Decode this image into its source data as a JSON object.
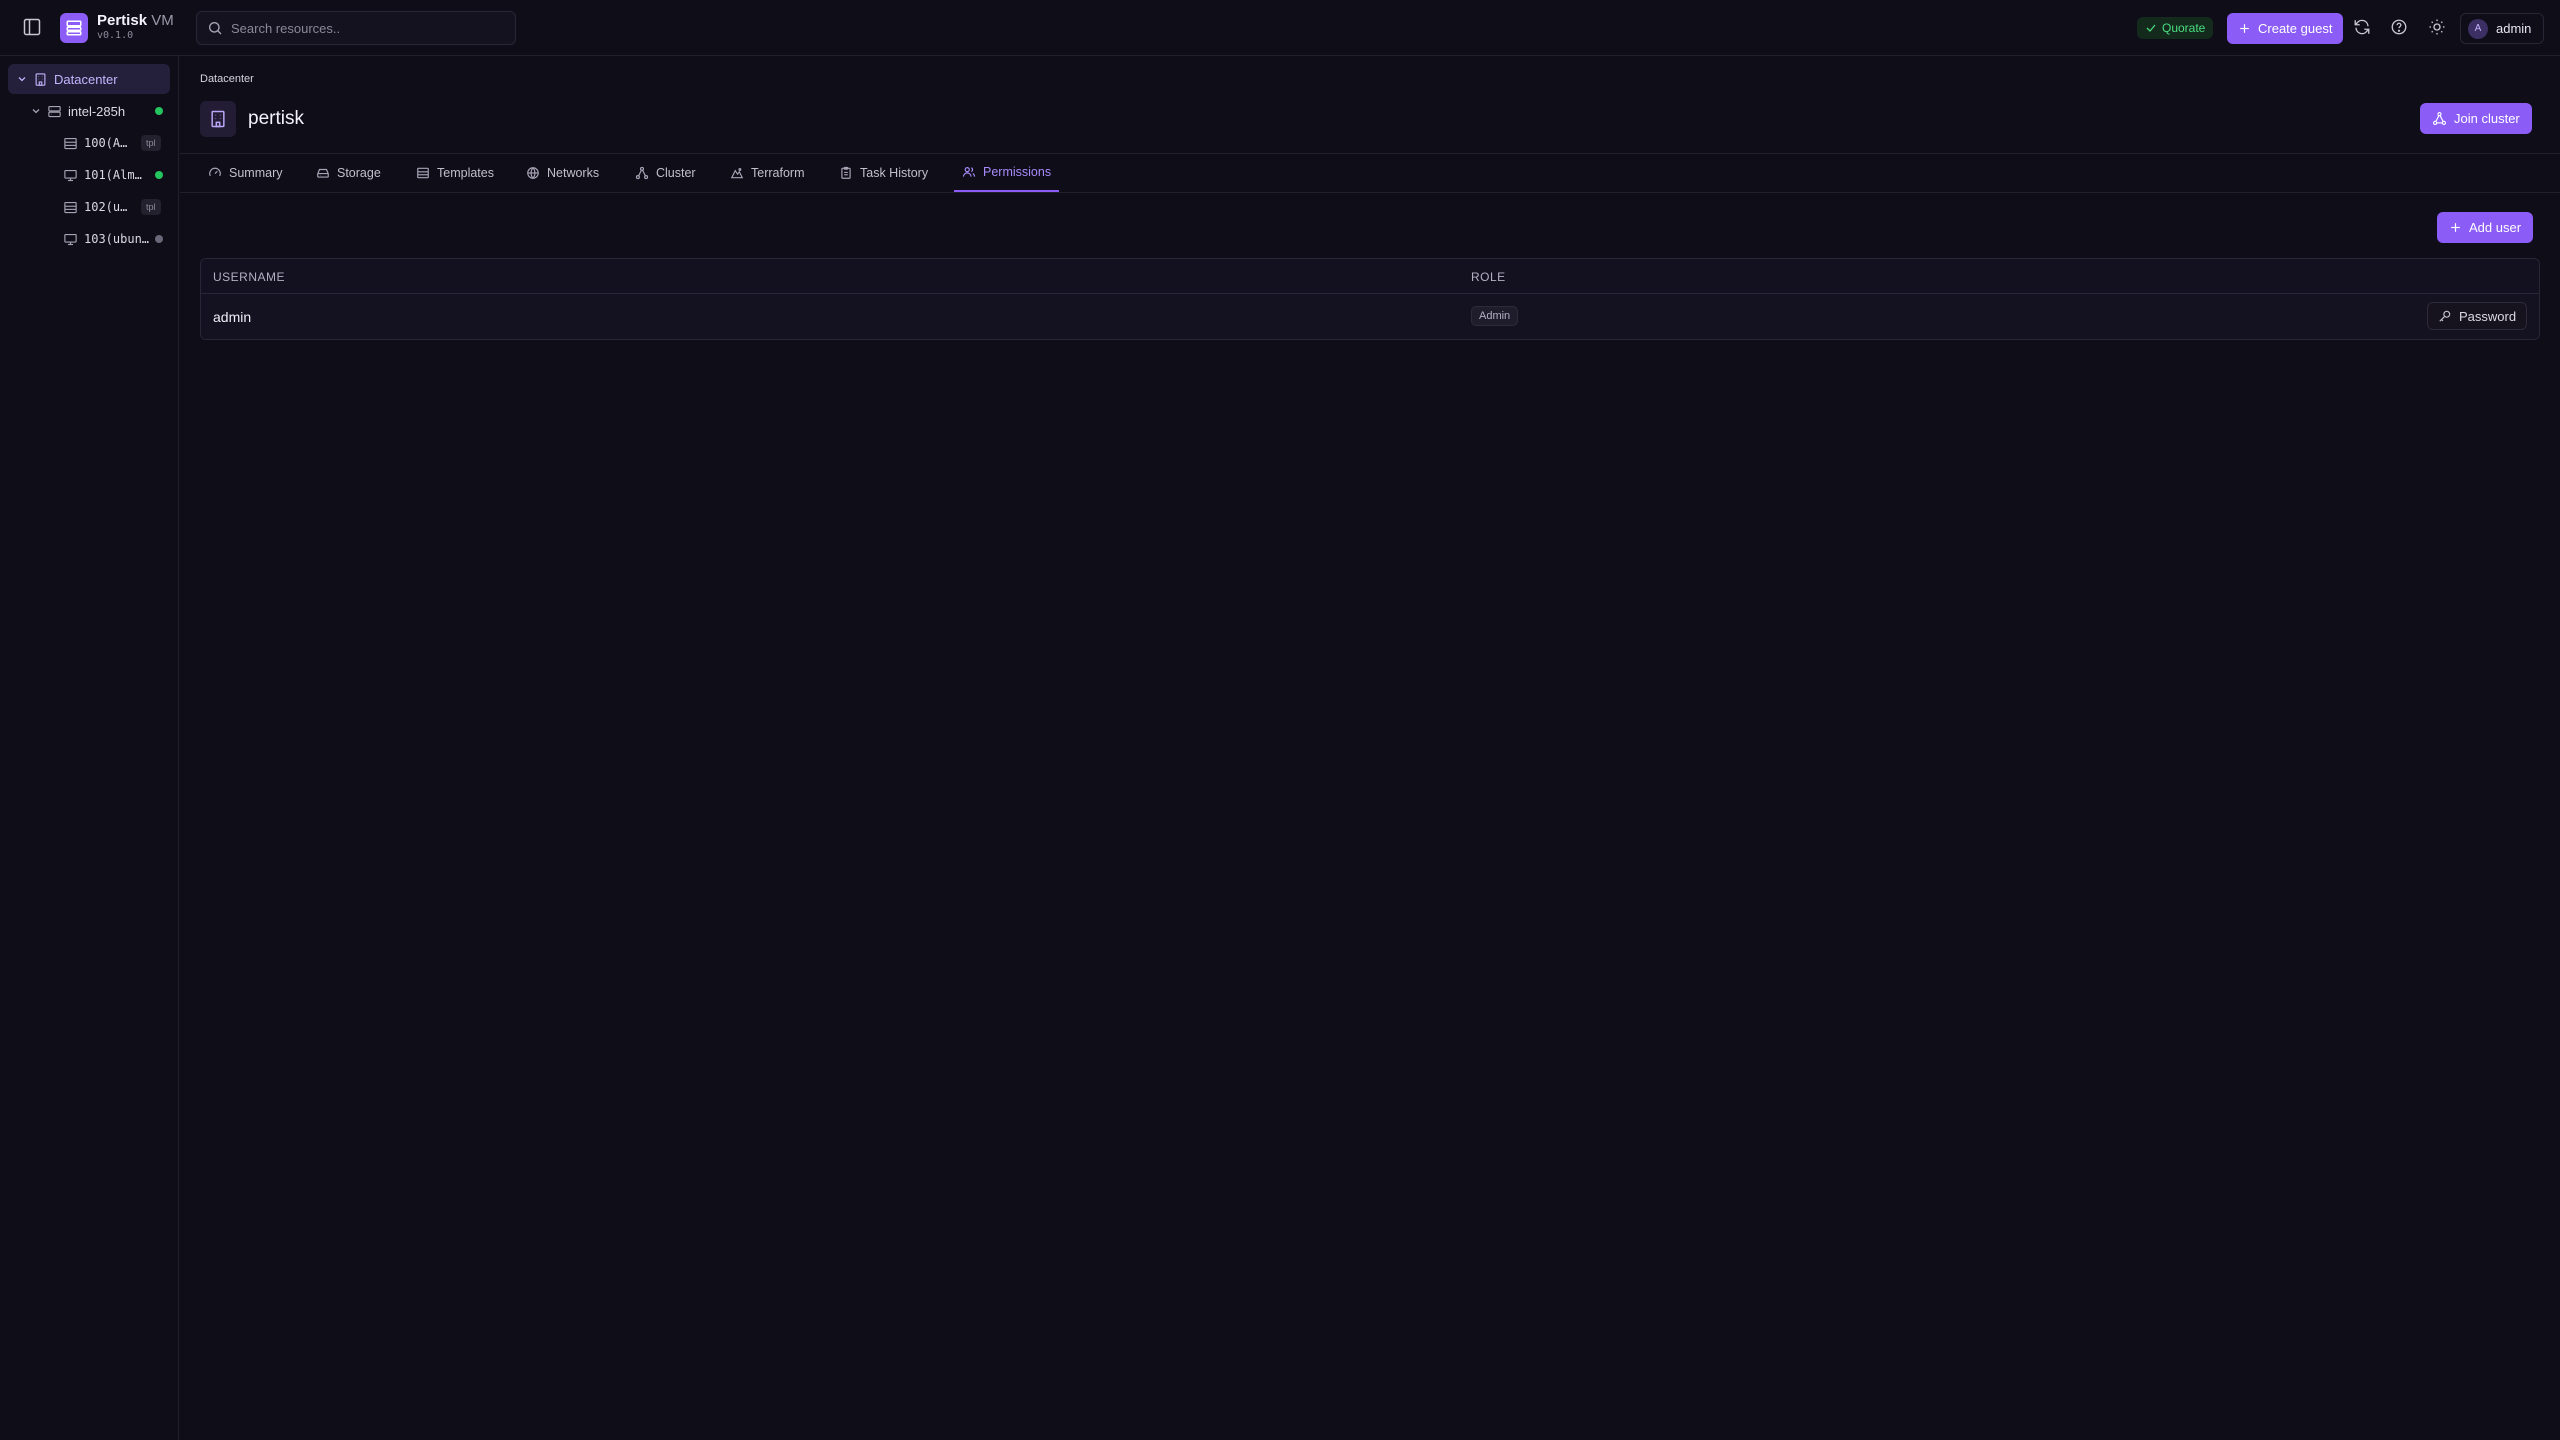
{
  "app": {
    "name": "Pertisk",
    "name_suffix": "VM",
    "version": "v0.1.0"
  },
  "search": {
    "placeholder": "Search resources.."
  },
  "header": {
    "status_label": "Quorate",
    "create_guest_label": "Create guest",
    "user": {
      "initial": "A",
      "name": "admin"
    }
  },
  "sidebar": {
    "datacenter": {
      "label": "Datacenter"
    },
    "node": {
      "label": "intel-285h",
      "status": "online"
    },
    "guests": [
      {
        "label": "100(A…",
        "badge": "tpl",
        "type": "template"
      },
      {
        "label": "101(Alm…",
        "status": "running",
        "type": "vm"
      },
      {
        "label": "102(u…",
        "badge": "tpl",
        "type": "template"
      },
      {
        "label": "103(ubun…",
        "status": "stopped",
        "type": "vm"
      }
    ]
  },
  "page": {
    "breadcrumb": "Datacenter",
    "title": "pertisk",
    "join_cluster_label": "Join cluster"
  },
  "tabs": [
    {
      "label": "Summary",
      "icon": "gauge-icon"
    },
    {
      "label": "Storage",
      "icon": "hard-drive-icon"
    },
    {
      "label": "Templates",
      "icon": "template-icon"
    },
    {
      "label": "Networks",
      "icon": "globe-icon"
    },
    {
      "label": "Cluster",
      "icon": "network-icon"
    },
    {
      "label": "Terraform",
      "icon": "terraform-icon"
    },
    {
      "label": "Task History",
      "icon": "clipboard-icon"
    },
    {
      "label": "Permissions",
      "icon": "users-icon",
      "active": true
    }
  ],
  "permissions": {
    "add_user_label": "Add user",
    "columns": {
      "username": "USERNAME",
      "role": "ROLE"
    },
    "rows": [
      {
        "username": "admin",
        "role": "Admin",
        "action_label": "Password"
      }
    ]
  },
  "colors": {
    "accent": "#8b5cf6",
    "background": "#0f0d18",
    "status_green": "#22c55e"
  }
}
